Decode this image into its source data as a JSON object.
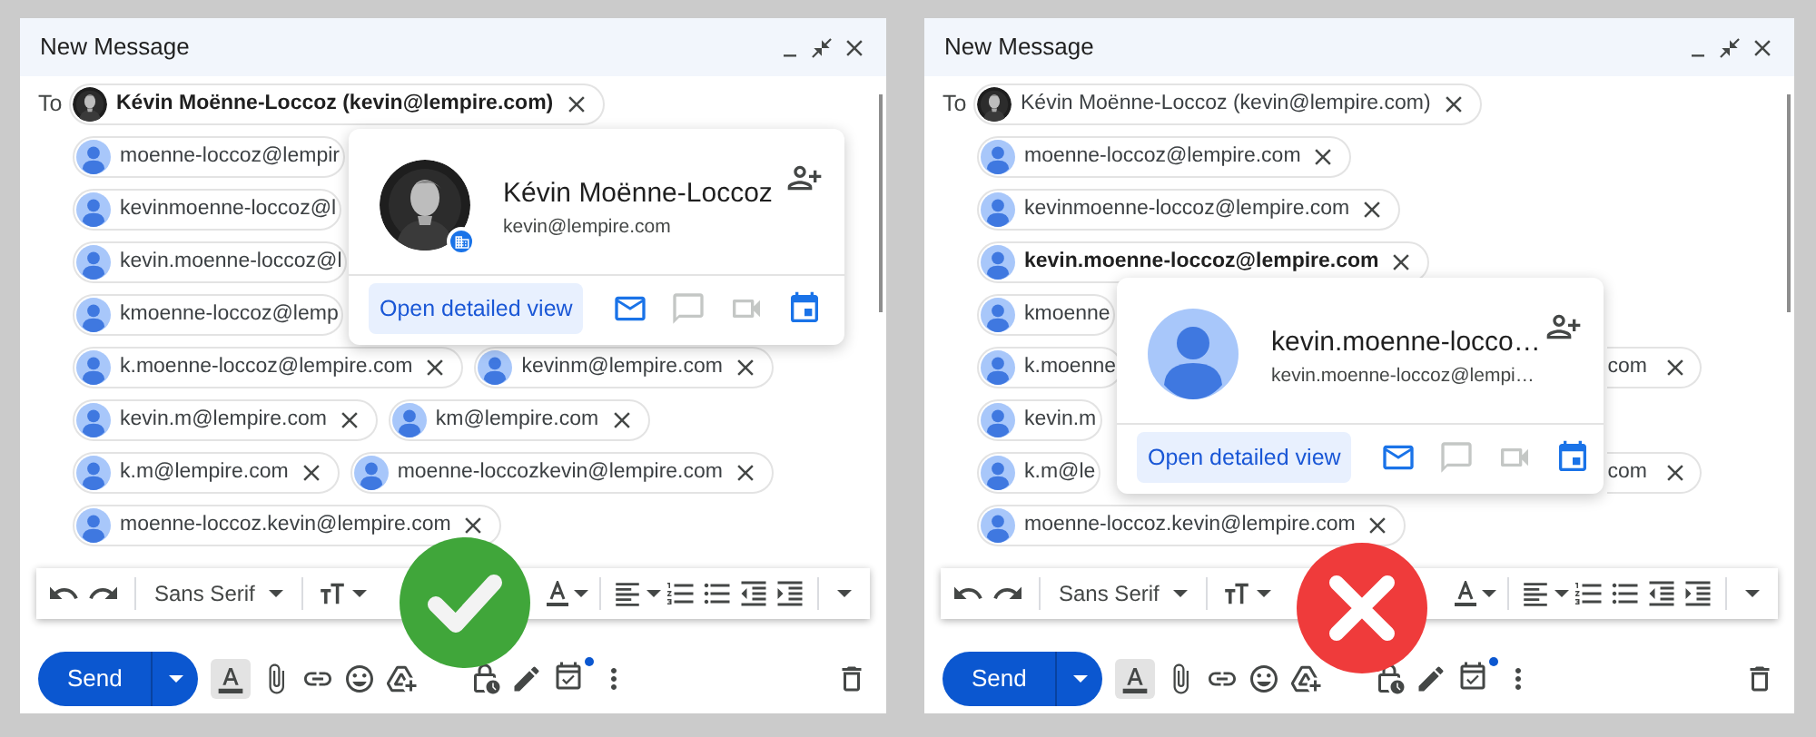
{
  "panels": [
    {
      "kind": "correct",
      "window": {
        "title": "New Message"
      },
      "to_label": "To",
      "recipient_rows": [
        [
          {
            "kind": "chip",
            "has_photo": true,
            "text": "Kévin Moënne-Loccoz (kevin@lempire.com)",
            "bold": true,
            "removable": true
          }
        ],
        [
          {
            "kind": "chip",
            "has_photo": false,
            "text": "moenne-loccoz@lempir",
            "bold": false,
            "removable": false
          }
        ],
        [
          {
            "kind": "chip",
            "has_photo": false,
            "text": "kevinmoenne-loccoz@l",
            "bold": false,
            "removable": false
          }
        ],
        [
          {
            "kind": "chip",
            "has_photo": false,
            "text": "kevin.moenne-loccoz@l",
            "bold": false,
            "removable": false
          }
        ],
        [
          {
            "kind": "chip",
            "has_photo": false,
            "text": "kmoenne-loccoz@lemp",
            "bold": false,
            "removable": false
          }
        ],
        [
          {
            "kind": "chip",
            "has_photo": false,
            "text": "k.moenne-loccoz@lempire.com",
            "bold": false,
            "removable": true
          },
          {
            "kind": "chip",
            "has_photo": false,
            "text": "kevinm@lempire.com",
            "bold": false,
            "removable": true
          }
        ],
        [
          {
            "kind": "chip",
            "has_photo": false,
            "text": "kevin.m@lempire.com",
            "bold": false,
            "removable": true
          },
          {
            "kind": "chip",
            "has_photo": false,
            "text": "km@lempire.com",
            "bold": false,
            "removable": true
          }
        ],
        [
          {
            "kind": "chip",
            "has_photo": false,
            "text": "k.m@lempire.com",
            "bold": false,
            "removable": true
          },
          {
            "kind": "chip",
            "has_photo": false,
            "text": "moenne-loccozkevin@lempire.com",
            "bold": false,
            "removable": true
          }
        ],
        [
          {
            "kind": "chip",
            "has_photo": false,
            "text": "moenne-loccoz.kevin@lempire.com",
            "bold": false,
            "removable": true
          }
        ]
      ],
      "contact_card": {
        "has_photo": true,
        "name": "Kévin Moënne-Loccoz",
        "email": "kevin@lempire.com",
        "action": "Open detailed view"
      },
      "toolbar": {
        "font": "Sans Serif"
      },
      "send": "Send"
    },
    {
      "kind": "wrong",
      "window": {
        "title": "New Message"
      },
      "to_label": "To",
      "recipient_rows": [
        [
          {
            "kind": "chip",
            "has_photo": true,
            "text": "Kévin Moënne-Loccoz (kevin@lempire.com)",
            "bold": false,
            "removable": true
          }
        ],
        [
          {
            "kind": "chip",
            "has_photo": false,
            "text": "moenne-loccoz@lempire.com",
            "bold": false,
            "removable": true
          }
        ],
        [
          {
            "kind": "chip",
            "has_photo": false,
            "text": "kevinmoenne-loccoz@lempire.com",
            "bold": false,
            "removable": true
          }
        ],
        [
          {
            "kind": "chip",
            "has_photo": false,
            "text": "kevin.moenne-loccoz@lempire.com",
            "bold": true,
            "removable": true
          }
        ],
        [
          {
            "kind": "chip",
            "has_photo": false,
            "text": "kmoenne",
            "bold": false,
            "removable": false
          }
        ],
        [
          {
            "kind": "chip",
            "has_photo": false,
            "text": "k.moenne",
            "bold": false,
            "removable": false
          },
          {
            "kind": "tail",
            "text": "com",
            "bold": false,
            "removable": true
          }
        ],
        [
          {
            "kind": "chip",
            "has_photo": false,
            "text": "kevin.m",
            "bold": false,
            "removable": false
          }
        ],
        [
          {
            "kind": "chip",
            "has_photo": false,
            "text": "k.m@le",
            "bold": false,
            "removable": false
          },
          {
            "kind": "tail",
            "text": "com",
            "bold": false,
            "removable": true
          }
        ],
        [
          {
            "kind": "chip",
            "has_photo": false,
            "text": "moenne-loccoz.kevin@lempire.com",
            "bold": false,
            "removable": true
          }
        ]
      ],
      "contact_card": {
        "has_photo": false,
        "name": "kevin.moenne-locco…",
        "email": "kevin.moenne-loccoz@lempi…",
        "action": "Open detailed view"
      },
      "toolbar": {
        "font": "Sans Serif"
      },
      "send": "Send"
    }
  ]
}
